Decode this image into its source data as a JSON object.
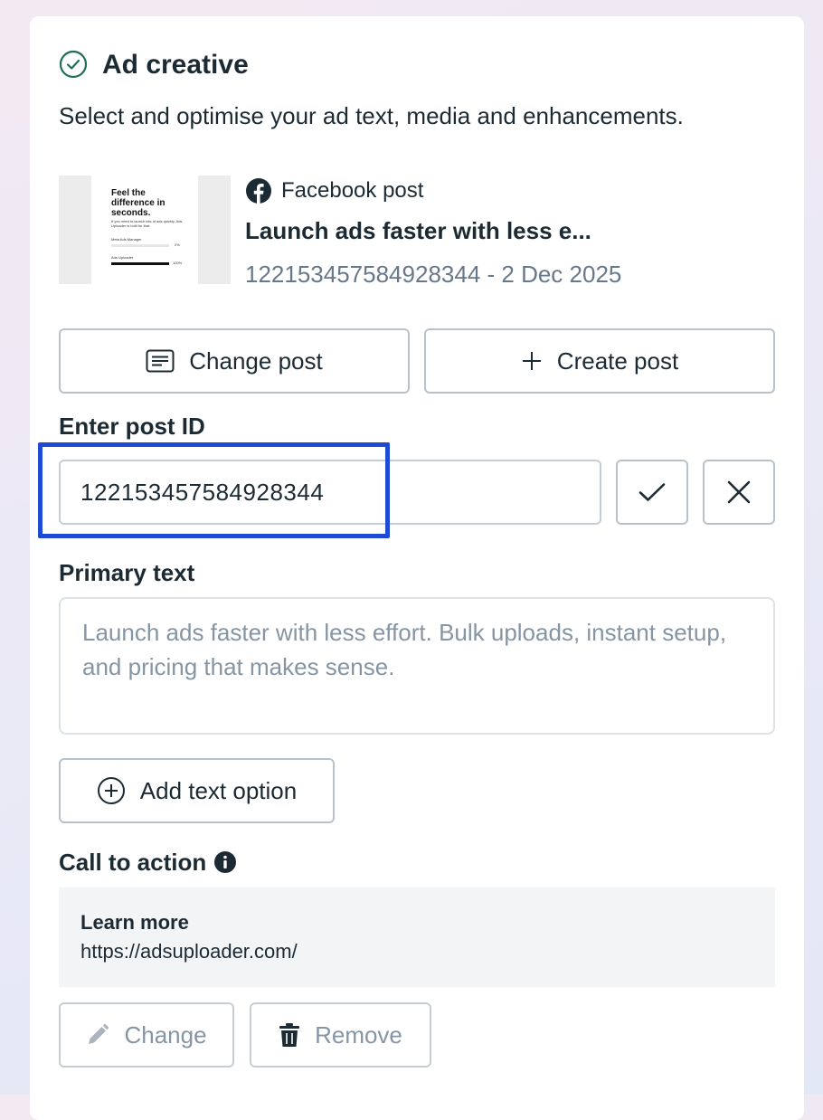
{
  "section": {
    "title": "Ad creative",
    "subtitle": "Select and optimise your ad text, media and enhancements.",
    "status_icon": "check-circle-icon"
  },
  "post": {
    "source_label": "Facebook post",
    "title": "Launch ads faster with less e...",
    "meta": "122153457584928344 - 2 Dec 2025",
    "thumbnail": {
      "headline": "Feel the difference in seconds.",
      "body": "If you need to launch lots of ads quickly, Ads Uploader is built for that.",
      "row1_label": "Meta Ads Manager",
      "row1_value": "2%",
      "row2_label": "Ads Uploader",
      "row2_value": "100%"
    }
  },
  "actions": {
    "change_post": "Change post",
    "create_post": "Create post"
  },
  "post_id": {
    "label": "Enter post ID",
    "value": "122153457584928344"
  },
  "primary_text": {
    "label": "Primary text",
    "placeholder": "Launch ads faster with less effort. Bulk uploads, instant setup, and pricing that makes sense."
  },
  "add_text_option": "Add text option",
  "cta": {
    "label": "Call to action",
    "title": "Learn more",
    "url": "https://adsuploader.com/",
    "change": "Change",
    "remove": "Remove"
  },
  "colors": {
    "accent_highlight": "#1e4bd2",
    "success": "#1f6e5a",
    "facebook": "#1c2b33"
  }
}
